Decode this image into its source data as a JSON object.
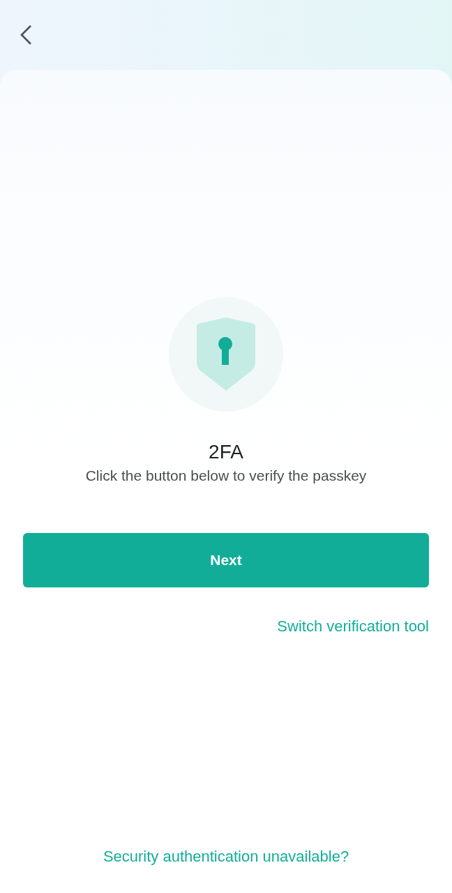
{
  "title": "2FA",
  "subtitle": "Click the button below to verify the passkey",
  "primary_button": "Next",
  "switch_link": "Switch verification tool",
  "footer_link": "Security authentication unavailable?"
}
